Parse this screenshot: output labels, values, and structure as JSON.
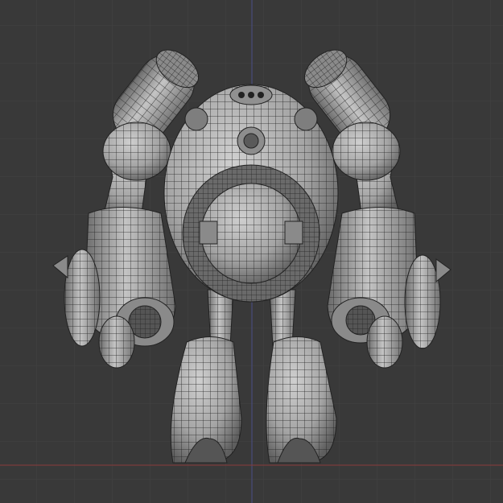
{
  "viewport": {
    "background_color": "#393939",
    "grid_color": "#424242",
    "x_axis_color": "#8a3a3a",
    "y_axis_color": "#4a4f86",
    "mesh_fill_color": "#aeaeae",
    "mesh_shadow_color": "#6d6d6d",
    "wire_color": "#1f1f1f",
    "object": "wireframe-robot-mesh"
  }
}
